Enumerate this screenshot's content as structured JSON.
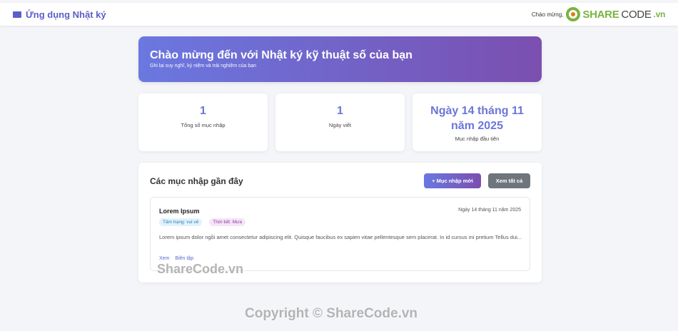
{
  "navbar": {
    "brand": "Ứng dụng Nhật ký",
    "greeting": "Chào mừng,",
    "logo_a": "SHARE",
    "logo_b": "CODE",
    "logo_c": ".vn"
  },
  "hero": {
    "title": "Chào mừng đến với Nhật ký kỹ thuật số của bạn",
    "subtitle": "Ghi lại suy nghĩ, kỷ niệm và trải nghiệm của bạn"
  },
  "stats": [
    {
      "value": "1",
      "label": "Tổng số mục nhập"
    },
    {
      "value": "1",
      "label": "Ngày viết"
    },
    {
      "value_line1": "Ngày 14 tháng 11",
      "value_line2": "năm 2025",
      "label": "Mục nhập đầu tiên"
    }
  ],
  "recent": {
    "title": "Các mục nhập gần đây",
    "new_button": "+ Mục nhập mới",
    "view_all_button": "Xem tất cả",
    "entries": [
      {
        "title": "Lorem Ipsum",
        "date": "Ngày 14 tháng 11 năm 2025",
        "mood": "Tâm trạng: vui vẻ",
        "weather": "Thời tiết: Mưa",
        "excerpt": "Lorem ipsum dolor ngồi amet consectetur adipiscing elit. Quisque faucibus ex sapien vitae pellentesque sem placerat. In id cursus mi pretium Tellus dui...",
        "view_label": "Xem",
        "edit_label": "Biên tập"
      }
    ]
  },
  "watermarks": {
    "top": "ShareCode.vn",
    "bottom": "Copyright © ShareCode.vn"
  },
  "colors": {
    "accent": "#6a78e0",
    "accent_end": "#7a4fb0",
    "secondary_button": "#6e757d"
  }
}
